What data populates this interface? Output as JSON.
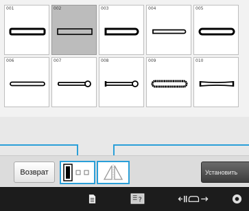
{
  "stitches": [
    {
      "id": "001",
      "selected": false,
      "icon": "rounded-buttonhole-bold-icon"
    },
    {
      "id": "002",
      "selected": true,
      "icon": "square-buttonhole-thin-icon"
    },
    {
      "id": "003",
      "selected": false,
      "icon": "rounded-end-buttonhole-icon"
    },
    {
      "id": "004",
      "selected": false,
      "icon": "narrow-rounded-buttonhole-icon"
    },
    {
      "id": "005",
      "selected": false,
      "icon": "rounded-both-ends-buttonhole-icon"
    },
    {
      "id": "006",
      "selected": false,
      "icon": "thin-rounded-buttonhole-icon"
    },
    {
      "id": "007",
      "selected": false,
      "icon": "keyhole-buttonhole-icon"
    },
    {
      "id": "008",
      "selected": false,
      "icon": "keyhole-bartack-buttonhole-icon"
    },
    {
      "id": "009",
      "selected": false,
      "icon": "stretch-buttonhole-icon"
    },
    {
      "id": "010",
      "selected": false,
      "icon": "tapered-buttonhole-icon"
    }
  ],
  "buttons": {
    "return_label": "Возврат",
    "set_label": "Установить"
  },
  "mode_selector": {
    "icon": "sewing-mode-selector-icon"
  },
  "mirror": {
    "icon": "mirror-image-icon"
  },
  "statusbar": {
    "icons": [
      "document-icon",
      "help-icon",
      "presser-foot-width-icon",
      "settings-icon"
    ]
  },
  "colors": {
    "accent": "#2a9fd8",
    "selected_cell": "#bcbcbc",
    "statusbar": "#1c1c1c"
  }
}
